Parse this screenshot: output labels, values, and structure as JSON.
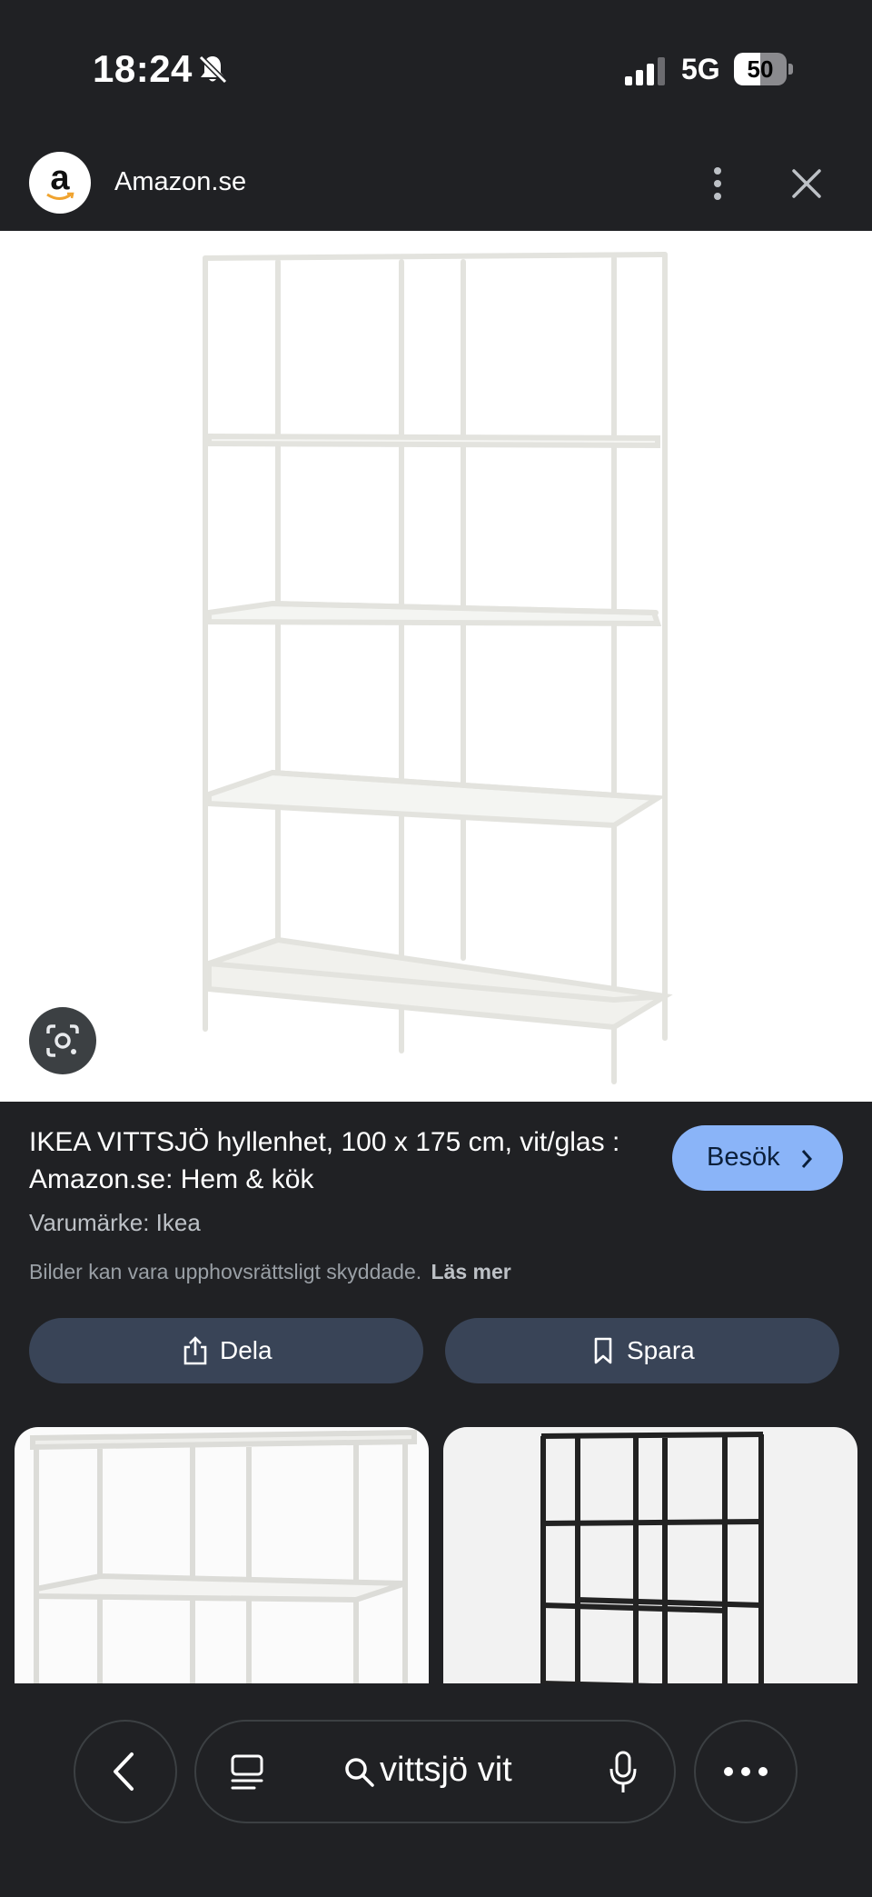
{
  "status_bar": {
    "time": "18:24",
    "network": "5G",
    "battery": "50",
    "battery_level": 0.5,
    "icons": [
      "bell-slash-icon",
      "signal-icon"
    ]
  },
  "site": {
    "logo_letter": "a",
    "name": "Amazon.se",
    "icons": [
      "more-vert-icon",
      "close-icon"
    ]
  },
  "result": {
    "title": "IKEA VITTSJÖ hyllenhet, 100 x 175 cm, vit/glas : Amazon.se: Hem & kök",
    "visit_label": "Besök",
    "brand": "Varumärke: Ikea",
    "copyright": "Bilder kan vara upphovsrättsligt skyddade.",
    "read_more": "Läs mer",
    "share_label": "Dela",
    "save_label": "Spara"
  },
  "bottom_bar": {
    "query": "vittsjö vit",
    "icons": [
      "back-icon",
      "tabs-icon",
      "search-icon",
      "mic-icon",
      "more-horiz-icon"
    ]
  },
  "colors": {
    "background": "#202124",
    "accent_button": "#8ab4f8",
    "pill_button": "#394457"
  }
}
